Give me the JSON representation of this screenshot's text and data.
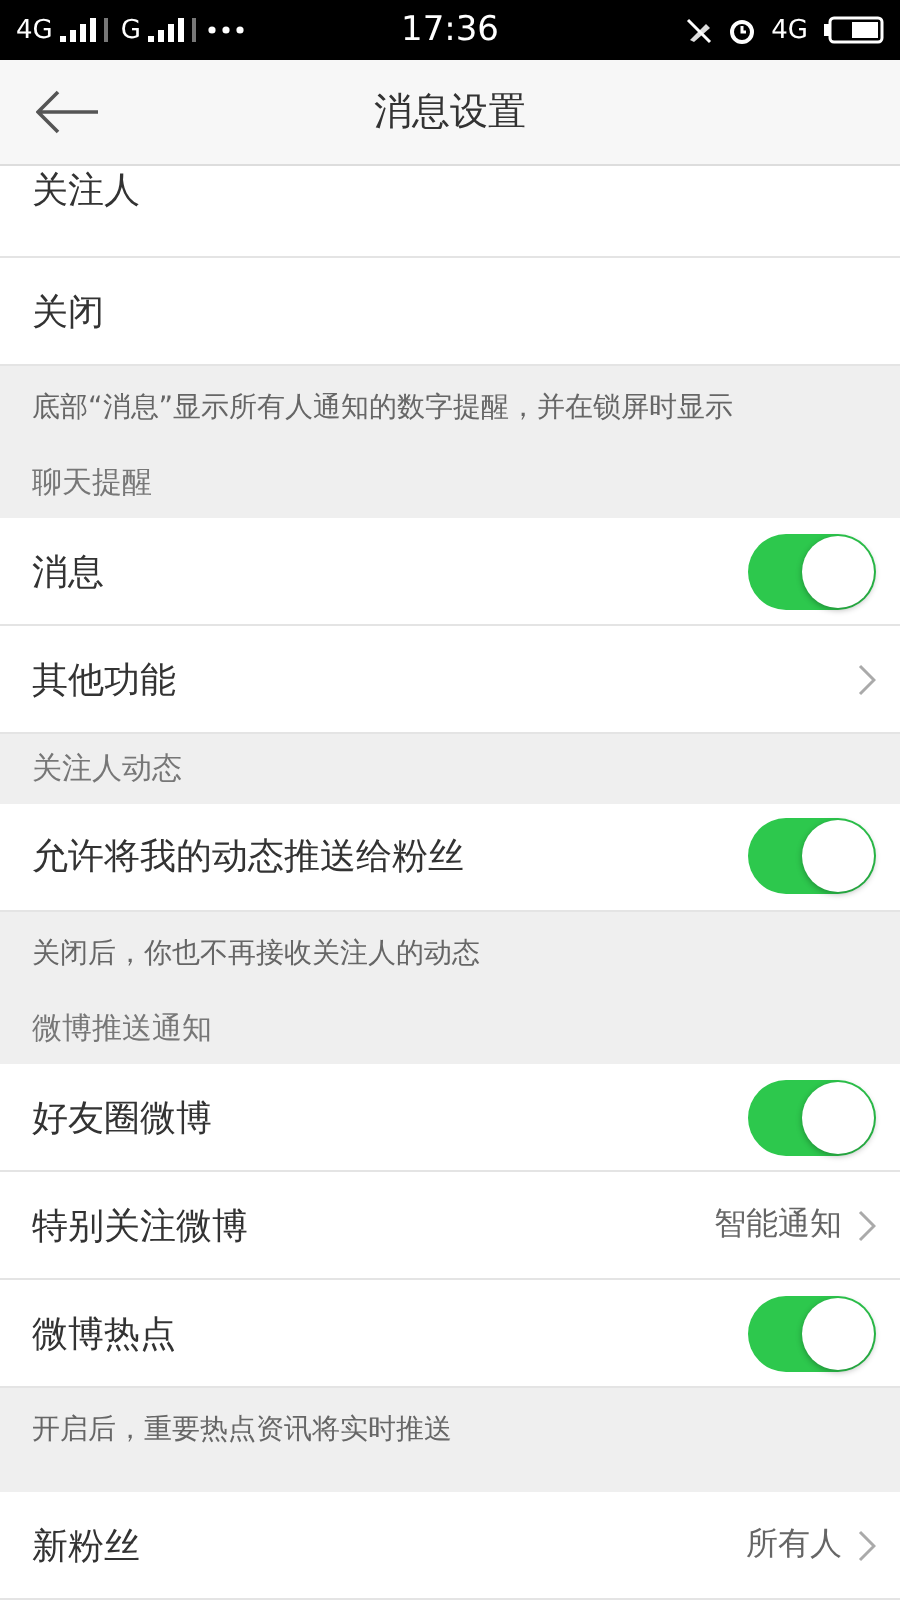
{
  "status_bar": {
    "carriers": [
      "4G",
      "G"
    ],
    "time": "17:36",
    "network": "4G"
  },
  "nav": {
    "title": "消息设置"
  },
  "sections": [
    {
      "items": [
        {
          "kind": "plain",
          "label": "关注人",
          "partial": true
        },
        {
          "kind": "plain",
          "label": "关闭"
        }
      ],
      "note": "底部“消息”显示所有人通知的数字提醒，并在锁屏时显示"
    },
    {
      "header": "聊天提醒",
      "items": [
        {
          "kind": "toggle",
          "label": "消息",
          "on": true
        },
        {
          "kind": "link",
          "label": "其他功能"
        }
      ]
    },
    {
      "header": "关注人动态",
      "items": [
        {
          "kind": "toggle",
          "label": "允许将我的动态推送给粉丝",
          "on": true
        }
      ],
      "note": "关闭后，你也不再接收关注人的动态"
    },
    {
      "header": "微博推送通知",
      "items": [
        {
          "kind": "toggle",
          "label": "好友圈微博",
          "on": true
        },
        {
          "kind": "link",
          "label": "特别关注微博",
          "value": "智能通知"
        },
        {
          "kind": "toggle",
          "label": "微博热点",
          "on": true
        }
      ],
      "note": "开启后，重要热点资讯将实时推送"
    },
    {
      "items": [
        {
          "kind": "link",
          "label": "新粉丝",
          "value": "所有人"
        }
      ]
    }
  ]
}
